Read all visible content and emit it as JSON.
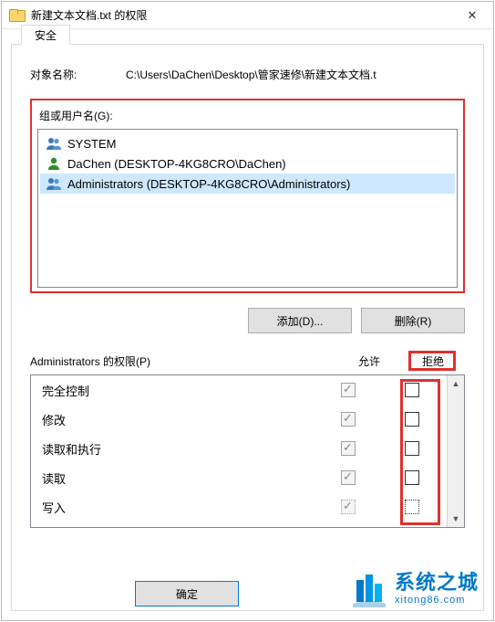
{
  "window": {
    "title": "新建文本文档.txt 的权限",
    "close_glyph": "✕"
  },
  "tab": {
    "label": "安全"
  },
  "object": {
    "label": "对象名称:",
    "path": "C:\\Users\\DaChen\\Desktop\\管家速修\\新建文本文档.t"
  },
  "groups": {
    "label": "组或用户名(G):",
    "principals": [
      {
        "name": "SYSTEM",
        "type": "group",
        "selected": false
      },
      {
        "name": "DaChen (DESKTOP-4KG8CRO\\DaChen)",
        "type": "user",
        "selected": false
      },
      {
        "name": "Administrators (DESKTOP-4KG8CRO\\Administrators)",
        "type": "group",
        "selected": true
      }
    ]
  },
  "buttons": {
    "add": "添加(D)...",
    "remove": "删除(R)",
    "ok": "确定"
  },
  "permissions": {
    "header": "Administrators 的权限(P)",
    "allow_label": "允许",
    "deny_label": "拒绝",
    "rows": [
      {
        "name": "完全控制",
        "allow": true,
        "allow_disabled": true,
        "deny": false
      },
      {
        "name": "修改",
        "allow": true,
        "allow_disabled": true,
        "deny": false
      },
      {
        "name": "读取和执行",
        "allow": true,
        "allow_disabled": true,
        "deny": false
      },
      {
        "name": "读取",
        "allow": true,
        "allow_disabled": true,
        "deny": false
      },
      {
        "name": "写入",
        "allow": true,
        "allow_disabled": true,
        "deny": false
      }
    ]
  },
  "watermark": {
    "cn": "系统之城",
    "url": "xitong86.com"
  }
}
